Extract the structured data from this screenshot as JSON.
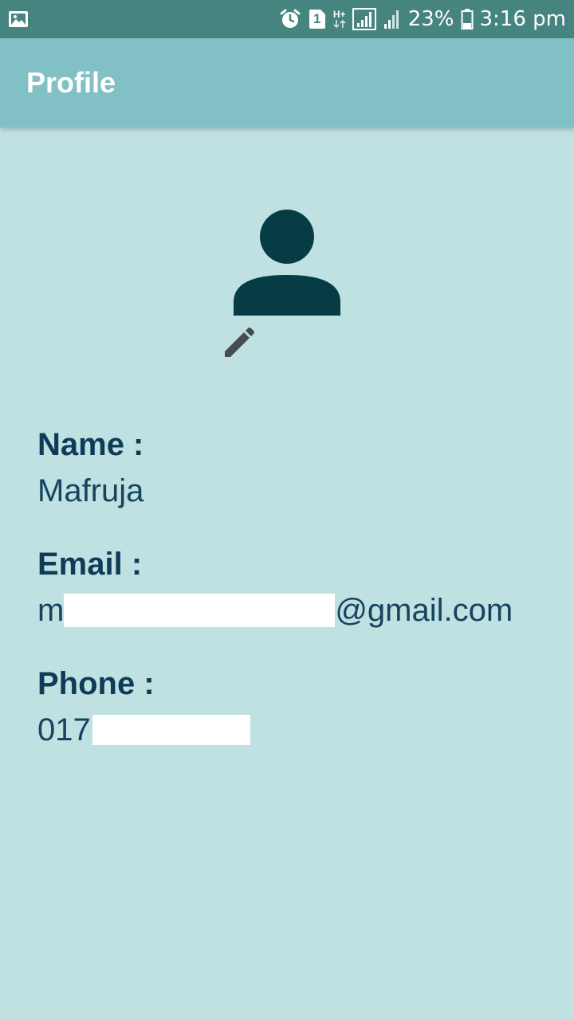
{
  "status_bar": {
    "icons": [
      "image-icon",
      "alarm-icon",
      "sim-1-icon",
      "hplus-data-icon",
      "signal-icon",
      "signal-2-icon",
      "battery-icon"
    ],
    "sim_label": "1",
    "network_label": "H+",
    "battery_percent": "23%",
    "time": "3:16 pm"
  },
  "toolbar": {
    "title": "Profile"
  },
  "avatar": {
    "icon": "person-icon",
    "color": "#073b45"
  },
  "edit": {
    "icon": "pencil-icon"
  },
  "fields": {
    "name": {
      "label": "Name :",
      "value": "Mafruja"
    },
    "email": {
      "label": "Email :",
      "value_prefix": "m",
      "value_suffix": "@gmail.com"
    },
    "phone": {
      "label": "Phone :",
      "value_prefix": "017"
    }
  },
  "colors": {
    "status_bar": "#45847f",
    "toolbar": "#81c1c6",
    "background": "#bfe1e2",
    "label": "#0f3b57"
  }
}
